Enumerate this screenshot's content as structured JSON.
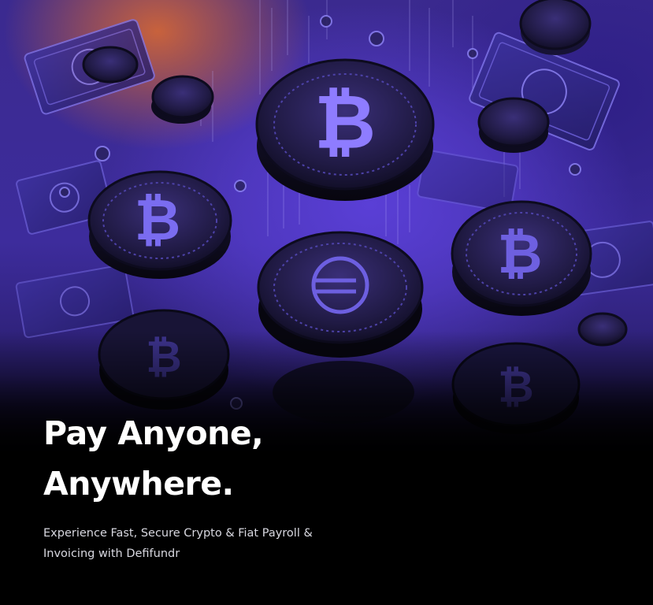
{
  "hero": {
    "headline_line1": "Pay Anyone,",
    "headline_line2": "Anywhere.",
    "subtitle": "Experience Fast, Secure Crypto & Fiat Payroll & Invoicing with Defifundr",
    "coin_symbol": "₿",
    "icons": [
      "bitcoin-coin-icon",
      "banknote-icon",
      "euro-coin-icon"
    ]
  },
  "colors": {
    "accent": "#5a3fd6",
    "glow": "#c8623c",
    "background": "#000000",
    "text": "#ffffff"
  }
}
